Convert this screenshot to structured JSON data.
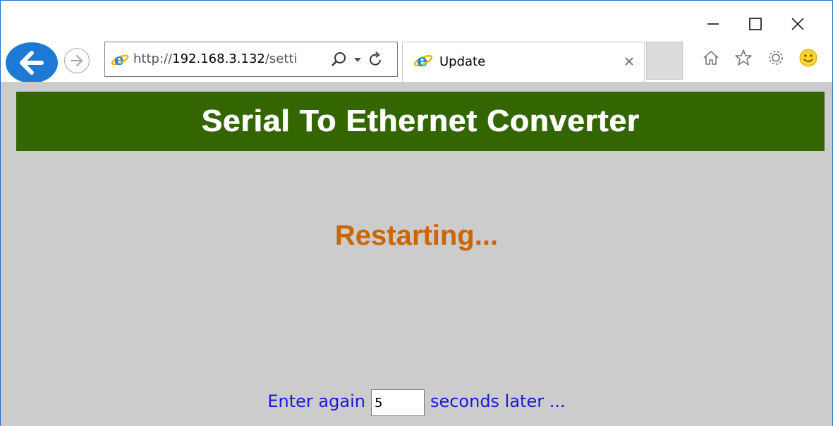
{
  "browser": {
    "address_scheme": "http://",
    "address_host": "192.168.3.132",
    "address_rest": "/setti",
    "tab_title": "Update",
    "controls": {
      "minimize": "minimize-icon",
      "maximize": "maximize-icon",
      "close": "close-icon"
    },
    "toolbar_icons": [
      "home-icon",
      "favorites-star-icon",
      "settings-gear-icon",
      "feedback-smiley-icon"
    ]
  },
  "page": {
    "header_title": "Serial To Ethernet Converter",
    "status": "Restarting...",
    "retry_prefix": "Enter again",
    "retry_value": "5",
    "retry_suffix": "seconds later ..."
  },
  "colors": {
    "banner": "#336600",
    "status": "#cc6600",
    "retry_text": "#1a1ad6",
    "page_bg": "#cccccc",
    "back_button": "#1c7ad4"
  }
}
